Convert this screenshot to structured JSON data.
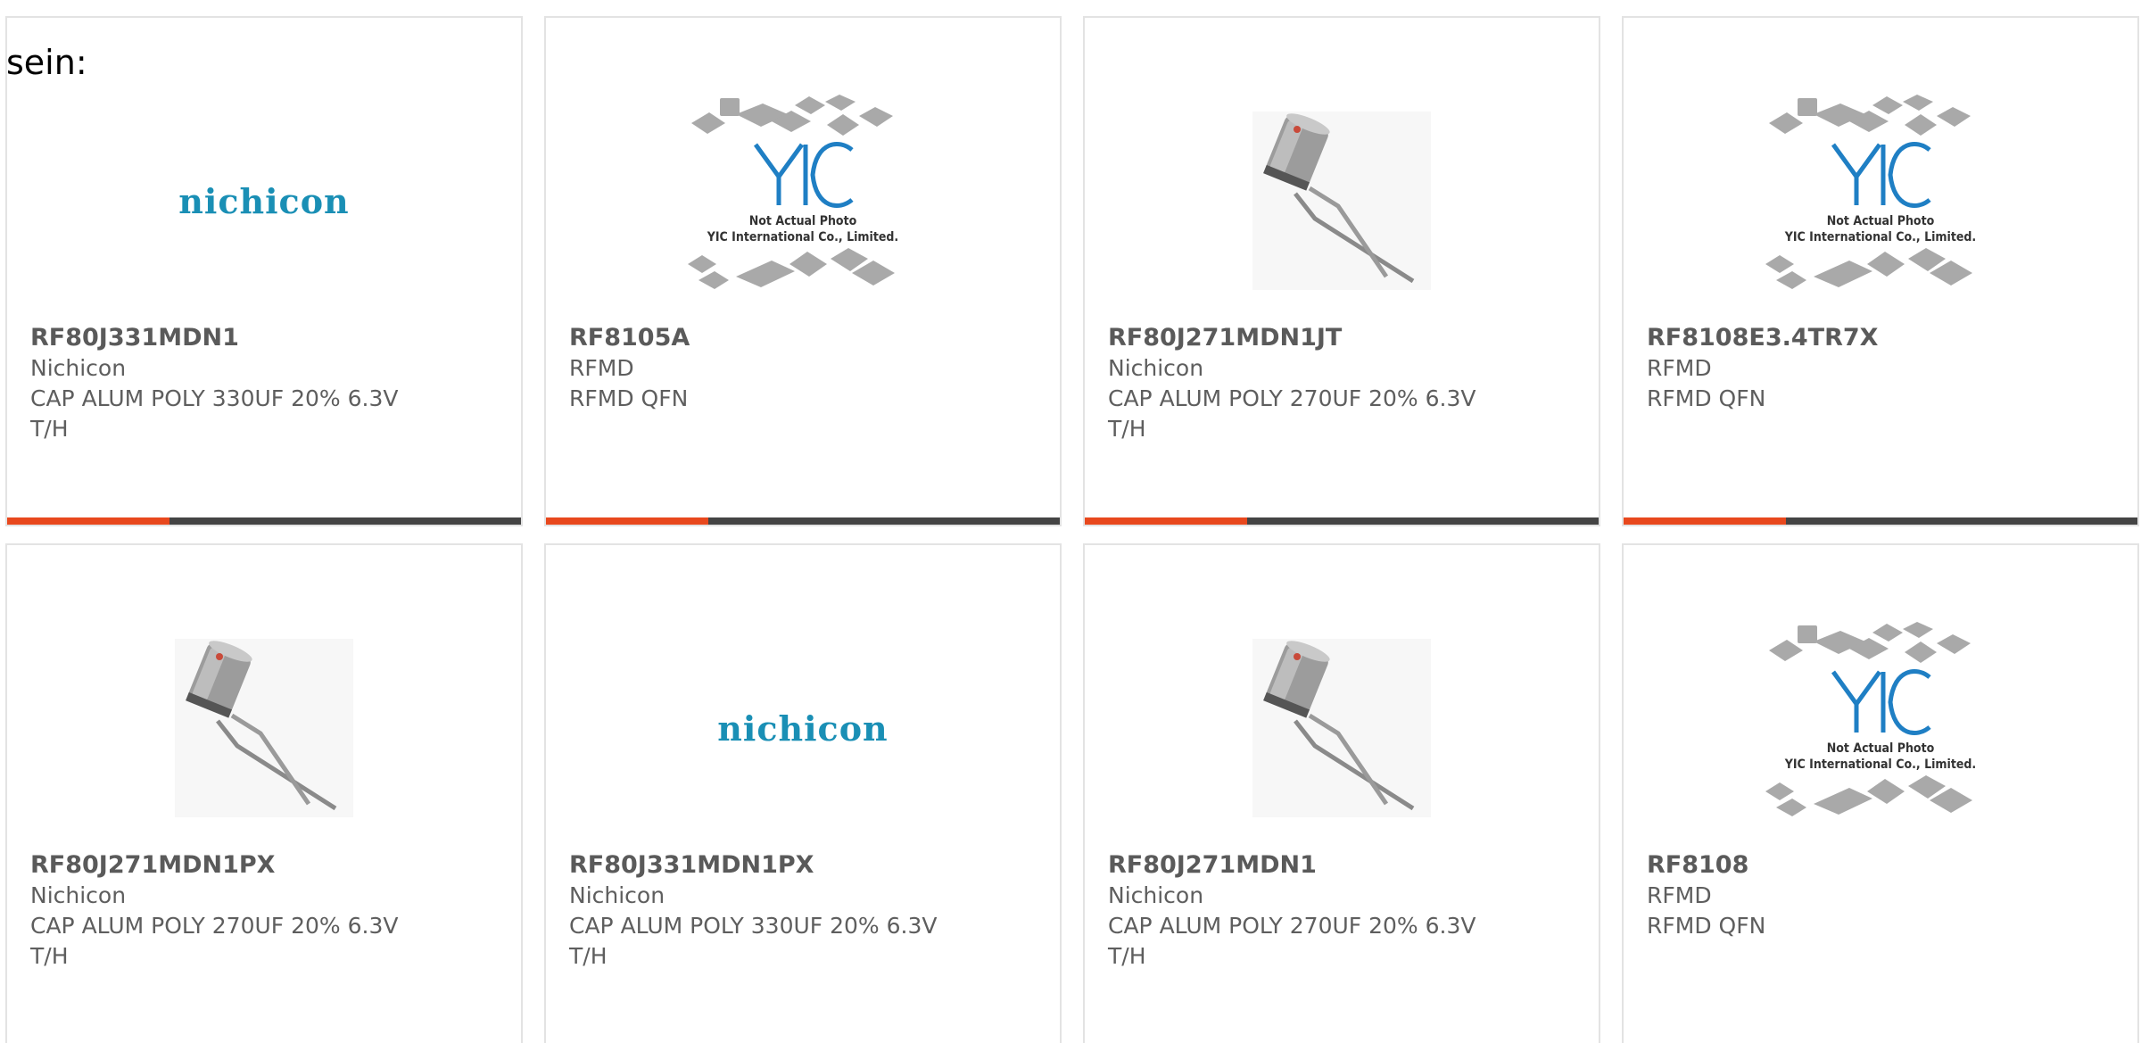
{
  "lead_text": "sein:",
  "products": [
    {
      "part_number": "RF80J331MDN1",
      "manufacturer": "Nichicon",
      "description": "CAP ALUM POLY 330UF 20% 6.3V T/H",
      "image": "nichicon-logo"
    },
    {
      "part_number": "RF8105A",
      "manufacturer": "RFMD",
      "description": "RFMD QFN",
      "image": "yic-placeholder"
    },
    {
      "part_number": "RF80J271MDN1JT",
      "manufacturer": "Nichicon",
      "description": "CAP ALUM POLY 270UF 20% 6.3V T/H",
      "image": "capacitor-photo"
    },
    {
      "part_number": "RF8108E3.4TR7X",
      "manufacturer": "RFMD",
      "description": "RFMD QFN",
      "image": "yic-placeholder"
    },
    {
      "part_number": "RF80J271MDN1PX",
      "manufacturer": "Nichicon",
      "description": "CAP ALUM POLY 270UF 20% 6.3V T/H",
      "image": "capacitor-photo"
    },
    {
      "part_number": "RF80J331MDN1PX",
      "manufacturer": "Nichicon",
      "description": "CAP ALUM POLY 330UF 20% 6.3V T/H",
      "image": "nichicon-logo"
    },
    {
      "part_number": "RF80J271MDN1",
      "manufacturer": "Nichicon",
      "description": "CAP ALUM POLY 270UF 20% 6.3V T/H",
      "image": "capacitor-photo"
    },
    {
      "part_number": "RF8108",
      "manufacturer": "RFMD",
      "description": "RFMD QFN",
      "image": "yic-placeholder"
    }
  ],
  "logos": {
    "nichicon": "nichicon",
    "yic_brand": "YIC",
    "yic_line1": "Not Actual Photo",
    "yic_line2": "YIC International Co., Limited."
  },
  "colors": {
    "accent": "#e8481d",
    "bar": "#444444",
    "nichicon_blue": "#1a8fb5",
    "yic_blue": "#1f7fc4"
  }
}
